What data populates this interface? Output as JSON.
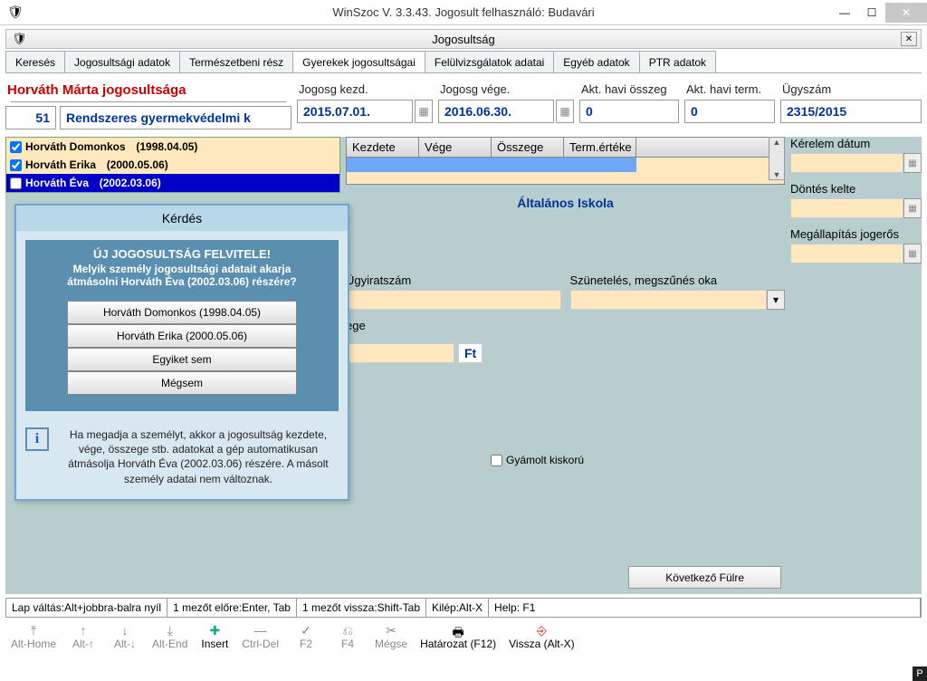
{
  "window": {
    "title": "WinSzoc V. 3.3.43. Jogosult felhasználó: Budavári"
  },
  "subwindow": {
    "title": "Jogosultság"
  },
  "tabs": [
    {
      "label": "Keresés"
    },
    {
      "label": "Jogosultsági adatok"
    },
    {
      "label": "Természetbeni rész"
    },
    {
      "label": "Gyerekek jogosultságai",
      "active": true
    },
    {
      "label": "Felülvizsgálatok adatai"
    },
    {
      "label": "Egyéb adatok"
    },
    {
      "label": "PTR adatok"
    }
  ],
  "header": {
    "entitlement_title": "Horváth Márta jogosultsága",
    "id_value": "51",
    "type_value": "Rendszeres gyermekvédelmi k",
    "start_label": "Jogosg kezd.",
    "start_value": "2015.07.01.",
    "end_label": "Jogosg vége.",
    "end_value": "2016.06.30.",
    "month_amount_label": "Akt. havi összeg",
    "month_amount_value": "0",
    "month_term_label": "Akt. havi term.",
    "month_term_value": "0",
    "case_label": "Ügyszám",
    "case_value": "2315/2015"
  },
  "persons": [
    {
      "name": "Horváth Domonkos",
      "dob": "(1998.04.05)",
      "checked": true
    },
    {
      "name": "Horváth Erika",
      "dob": "(2000.05.06)",
      "checked": true
    },
    {
      "name": "Horváth Éva",
      "dob": "(2002.03.06)",
      "checked": false,
      "selected": true
    }
  ],
  "table_cols": [
    "Kezdete",
    "Vége",
    "Összege",
    "Term.értéke"
  ],
  "center_text": "Általános Iskola",
  "fields": {
    "case_no": "Ügyiratszám",
    "pause_reason": "Szünetelés, megszűnés oka",
    "amount_label": "ege",
    "ft": "Ft",
    "ward_minor": "Gyámolt kiskorú"
  },
  "right": {
    "req_date": "Kérelem dátum",
    "dec_date": "Döntés kelte",
    "final_date": "Megállapítás jogerős"
  },
  "next_tab": "Következő Fülre",
  "status": [
    "Lap váltás:Alt+jobbra-balra nyíl",
    "1 mezőt előre:Enter, Tab",
    "1 mezőt vissza:Shift-Tab",
    "Kilép:Alt-X",
    "Help: F1"
  ],
  "toolbar": [
    {
      "label": "Alt-Home",
      "icon": "⤒"
    },
    {
      "label": "Alt-↑",
      "icon": "↑"
    },
    {
      "label": "Alt-↓",
      "icon": "↓"
    },
    {
      "label": "Alt-End",
      "icon": "⤓"
    },
    {
      "label": "Insert",
      "icon": "✚",
      "enabled": true
    },
    {
      "label": "Ctrl-Del",
      "icon": "—"
    },
    {
      "label": "F2",
      "icon": "✓"
    },
    {
      "label": "F4",
      "icon": "⎌"
    },
    {
      "label": "Mégse",
      "icon": "✂"
    },
    {
      "label": "Határozat (F12)",
      "icon": "🖶",
      "enabled": true
    },
    {
      "label": "Vissza (Alt-X)",
      "icon": "⎆",
      "enabled": true
    }
  ],
  "dialog": {
    "title": "Kérdés",
    "heading": "ÚJ JOGOSULTSÁG FELVITELE!",
    "question_l1": "Melyik személy jogosultsági adatait akarja",
    "question_l2": "átmásolni Horváth Éva    (2002.03.06) részére?",
    "buttons": [
      "Horváth Domonkos    (1998.04.05)",
      "Horváth Erika    (2000.05.06)",
      "Egyiket sem",
      "Mégsem"
    ],
    "info": "Ha megadja a személyt, akkor a jogosultság kezdete, vége, összege stb. adatokat a gép automatikusan átmásolja Horváth Éva (2002.03.06) részére. A másolt személy adatai nem változnak."
  }
}
